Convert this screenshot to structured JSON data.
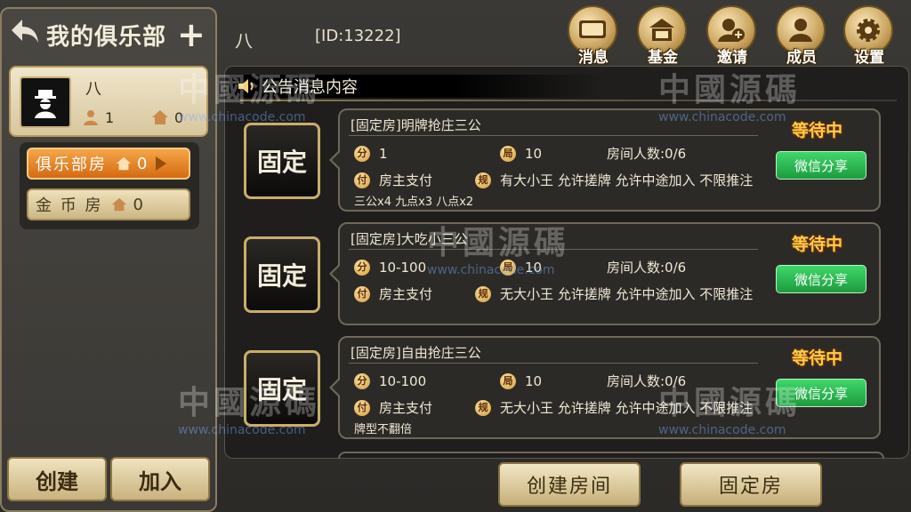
{
  "club": {
    "title": "我的俱乐部",
    "name": "八",
    "members": "1",
    "rooms": "0"
  },
  "room_tabs": [
    {
      "label": "俱乐部房",
      "count": "0"
    },
    {
      "label": "金 币 房",
      "count": "0"
    }
  ],
  "bottom_left": {
    "create": "创建",
    "join": "加入"
  },
  "header": {
    "name": "八",
    "id": "[ID:13222]"
  },
  "top_buttons": [
    {
      "label": "消息",
      "icon": "message-icon"
    },
    {
      "label": "基金",
      "icon": "fund-icon"
    },
    {
      "label": "邀请",
      "icon": "invite-icon"
    },
    {
      "label": "成员",
      "icon": "members-icon"
    },
    {
      "label": "设置",
      "icon": "settings-icon"
    }
  ],
  "notice": "公告消息内容",
  "rooms": [
    {
      "badge": "固定",
      "title": "[固定房]明牌抢庄三公",
      "chip_fen": "分",
      "fen": "1",
      "chip_ju": "局",
      "ju": "10",
      "players": "房间人数:0/6",
      "chip_fu": "付",
      "pay": "房主支付",
      "chip_gui": "规",
      "rules": "有大小王 允许搓牌 允许中途加入 不限推注",
      "extra": "三公x4  九点x3  八点x2",
      "status": "等待中",
      "share": "微信分享"
    },
    {
      "badge": "固定",
      "title": "[固定房]大吃小三公",
      "chip_fen": "分",
      "fen": "10-100",
      "chip_ju": "局",
      "ju": "10",
      "players": "房间人数:0/6",
      "chip_fu": "付",
      "pay": "房主支付",
      "chip_gui": "规",
      "rules": "无大小王 允许搓牌 允许中途加入 不限推注",
      "extra": "",
      "status": "等待中",
      "share": "微信分享"
    },
    {
      "badge": "固定",
      "title": "[固定房]自由抢庄三公",
      "chip_fen": "分",
      "fen": "10-100",
      "chip_ju": "局",
      "ju": "10",
      "players": "房间人数:0/6",
      "chip_fu": "付",
      "pay": "房主支付",
      "chip_gui": "规",
      "rules": "无大小王 允许搓牌 允许中途加入 不限推注",
      "extra": "牌型不翻倍",
      "status": "等待中",
      "share": "微信分享"
    }
  ],
  "bottom_right": {
    "create_room": "创建房间",
    "fixed_room": "固定房"
  },
  "watermark": {
    "text": "中國源碼",
    "url": "www.chinacode.com"
  },
  "colors": {
    "accent": "#c9ad6b",
    "status": "#ffcd4a",
    "share": "#2cbf55",
    "active_tab": "#e8862c"
  }
}
